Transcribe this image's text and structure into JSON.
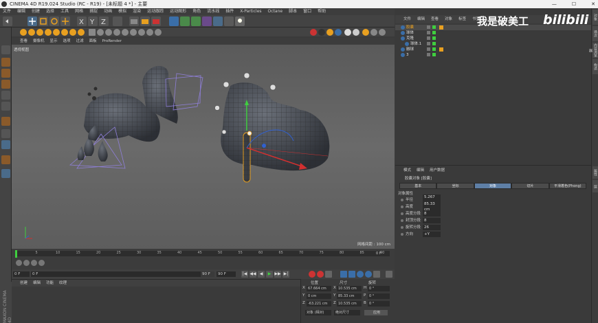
{
  "app": {
    "title": "CINEMA 4D R19.024 Studio (RC - R19) - [未标题 4 *] - 主要",
    "window_min": "—",
    "window_max": "☐",
    "window_close": "✕"
  },
  "menu": [
    "文件",
    "编辑",
    "创建",
    "选择",
    "工具",
    "网格",
    "捕捉",
    "动画",
    "模拟",
    "渲染",
    "运动跟踪",
    "运动图形",
    "角色",
    "流水线",
    "插件",
    "X-Particles",
    "Octane",
    "脚本",
    "窗口",
    "帮助"
  ],
  "viewport": {
    "menu": [
      "查看",
      "摄像机",
      "显示",
      "选项",
      "过滤",
      "面板",
      "ProRender"
    ],
    "label": "透视视图",
    "grid_label": "网格间距 : 100 cm"
  },
  "timeline": {
    "ticks": [
      "0",
      "5",
      "10",
      "15",
      "20",
      "25",
      "30",
      "35",
      "40",
      "45",
      "50",
      "55",
      "60",
      "65",
      "70",
      "75",
      "80",
      "85",
      "90"
    ],
    "end_label": "0 F",
    "start_field": "0 F",
    "current_field": "0 F",
    "end_field": "90 F",
    "end_field2": "90 F"
  },
  "transport_buttons": [
    "|◀",
    "◀◀",
    "◀",
    "▶",
    "▶▶",
    "▶|"
  ],
  "bottom_manager": {
    "tabs": [
      "创建",
      "编辑",
      "功能",
      "纹理"
    ]
  },
  "maxon": "MAXON CINEMA 4D",
  "coords": {
    "headers": [
      "位置",
      "尺寸",
      "旋转"
    ],
    "rows": [
      {
        "axis": "X",
        "pos": "67.664 cm",
        "size_axis": "X",
        "size": "10.535 cm",
        "rot_axis": "H",
        "rot": "0 °"
      },
      {
        "axis": "Y",
        "pos": "0 cm",
        "size_axis": "Y",
        "size": "85.33 cm",
        "rot_axis": "P",
        "rot": "0 °"
      },
      {
        "axis": "Z",
        "pos": "-63.221 cm",
        "size_axis": "Z",
        "size": "10.535 cm",
        "rot_axis": "B",
        "rot": "0 °"
      }
    ],
    "mode1": "对象 (相对)",
    "mode2": "绝对尺寸",
    "apply": "应用"
  },
  "object_manager": {
    "tabs": [
      "文件",
      "编辑",
      "查看",
      "对象",
      "标签",
      "书签"
    ],
    "objects": [
      {
        "name": "胶囊",
        "color": "#e8a020"
      },
      {
        "name": "球体",
        "color": "#ddd"
      },
      {
        "name": "克隆",
        "color": "#ddd"
      },
      {
        "name": "球体.1",
        "color": "#ddd"
      },
      {
        "name": "融球",
        "color": "#ddd"
      },
      {
        "name": "3",
        "color": "#ddd"
      }
    ]
  },
  "attributes": {
    "tabs": [
      "模式",
      "编辑",
      "用户数据"
    ],
    "title": "胶囊对象 [胶囊]",
    "buttons": [
      "基本",
      "坐标",
      "对象",
      "切片",
      "平滑着色(Phong)"
    ],
    "active_button": 2,
    "section": "对象属性",
    "rows": [
      {
        "label": "半径",
        "value": "5.267 cm"
      },
      {
        "label": "高度",
        "value": "85.33 cm"
      },
      {
        "label": "高度分段",
        "value": "8"
      },
      {
        "label": "封顶分段",
        "value": "8"
      },
      {
        "label": "旋转分段",
        "value": "26"
      },
      {
        "label": "方向",
        "value": "+Y"
      }
    ]
  },
  "side_tabs": [
    "对象",
    "场次",
    "内容浏览器",
    "构造"
  ],
  "side_tabs_lower": [
    "属性",
    "层"
  ],
  "watermark": {
    "text": "我是破美工",
    "logo": "bilibili"
  }
}
